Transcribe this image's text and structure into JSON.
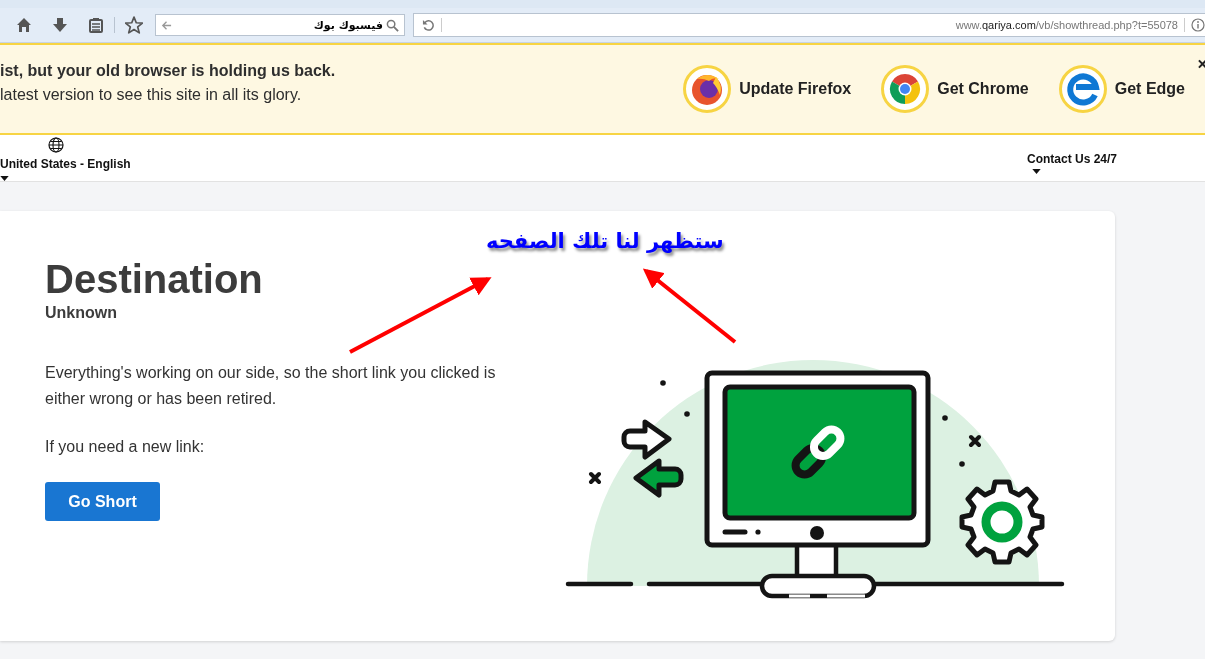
{
  "browser": {
    "search_field": {
      "value": "فيسبوك بوك"
    },
    "address": {
      "prefix": "www.",
      "domain": "qariya.com",
      "path": "/vb/showthread.php?t=55078"
    }
  },
  "banner": {
    "lines": [
      "ist, but your old browser is holding us back.",
      "latest version to see this site in all its glory."
    ],
    "browsers": [
      {
        "label": "Update Firefox",
        "kind": "firefox"
      },
      {
        "label": "Get Chrome",
        "kind": "chrome"
      },
      {
        "label": "Get Edge",
        "kind": "edge"
      }
    ]
  },
  "nav": {
    "locale": "United States - English",
    "contact": "Contact Us 24/7"
  },
  "card": {
    "title": "Destination",
    "subtitle": "Unknown",
    "message": "Everything's working on our side, so the short link you clicked is either wrong or has been retired.",
    "prompt": "If you need a new link:",
    "button": "Go Short"
  },
  "annotation": {
    "text": "ستظهر لنا تلك الصفحه"
  }
}
